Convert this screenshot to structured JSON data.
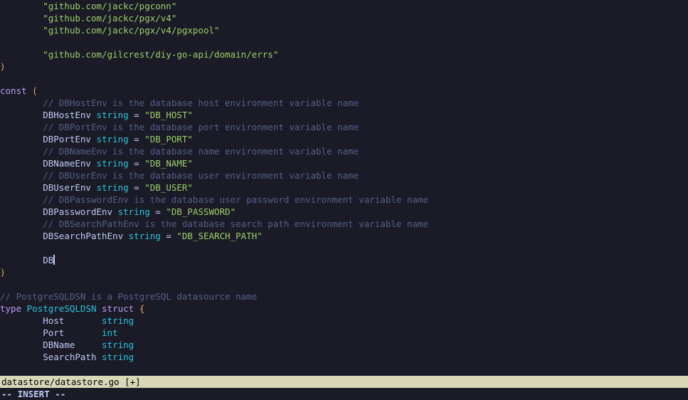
{
  "code": {
    "import1": "\"github.com/jackc/pgconn\"",
    "import2": "\"github.com/jackc/pgx/v4\"",
    "import3": "\"github.com/jackc/pgx/v4/pgxpool\"",
    "import4": "\"github.com/gilcrest/diy-go-api/domain/errs\"",
    "close_paren": ")",
    "const_kw": "const",
    "open_paren": "(",
    "cmt_host": "// DBHostEnv is the database host environment variable name",
    "id_host": "DBHostEnv",
    "val_host": "\"DB_HOST\"",
    "cmt_port": "// DBPortEnv is the database port environment variable name",
    "id_port": "DBPortEnv",
    "val_port": "\"DB_PORT\"",
    "cmt_name": "// DBNameEnv is the database name environment variable name",
    "id_name": "DBNameEnv",
    "val_name": "\"DB_NAME\"",
    "cmt_user": "// DBUserEnv is the database user environment variable name",
    "id_user": "DBUserEnv",
    "val_user": "\"DB_USER\"",
    "cmt_pass": "// DBPasswordEnv is the database user password environment variable name",
    "id_pass": "DBPasswordEnv",
    "val_pass": "\"DB_PASSWORD\"",
    "cmt_sp": "// DBSearchPathEnv is the database search path environment variable name",
    "id_sp": "DBSearchPathEnv",
    "val_sp": "\"DB_SEARCH_PATH\"",
    "typed": "DB",
    "type_string": "string",
    "eq": " = ",
    "cmt_dsn": "// PostgreSQLDSN is a PostgreSQL datasource name",
    "type_kw": "type",
    "dsn_name": "PostgreSQLDSN",
    "struct_kw": "struct",
    "brace_open": "{",
    "field_host": "Host",
    "field_port": "Port",
    "field_dbname": "DBName",
    "field_search": "SearchPath",
    "type_int": "int"
  },
  "status": {
    "file": "datastore/datastore.go",
    "modified": "[+]"
  },
  "mode": "-- INSERT --"
}
